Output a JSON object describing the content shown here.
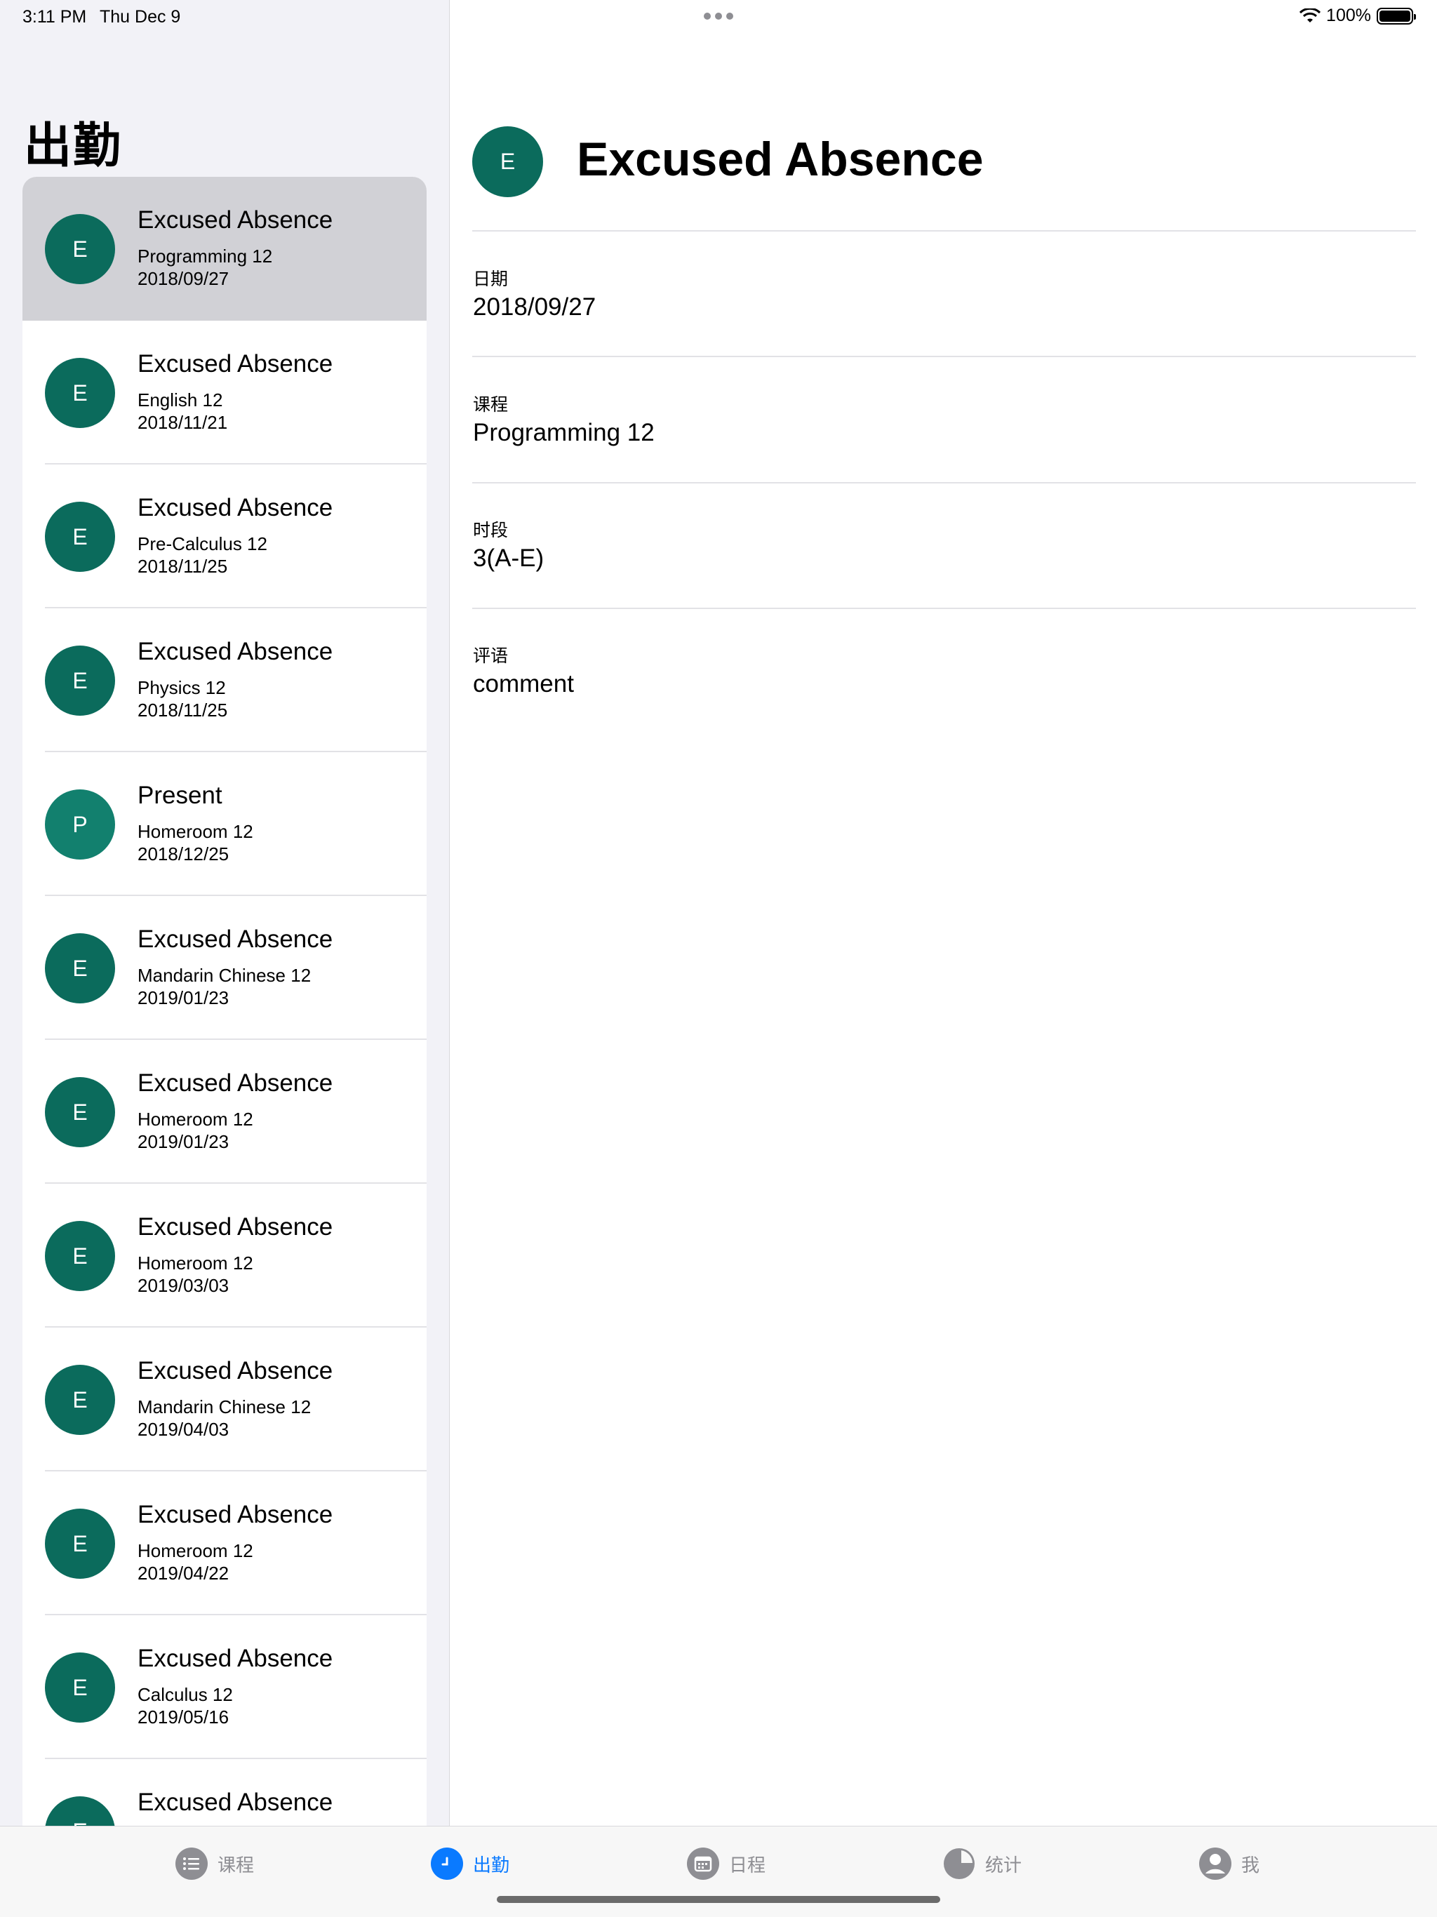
{
  "status_bar": {
    "time": "3:11 PM",
    "date": "Thu Dec 9",
    "battery": "100%"
  },
  "sidebar": {
    "title": "出勤",
    "items": [
      {
        "avatar": "E",
        "title": "Excused Absence",
        "course": "Programming 12",
        "date": "2018/09/27"
      },
      {
        "avatar": "E",
        "title": "Excused Absence",
        "course": "English 12",
        "date": "2018/11/21"
      },
      {
        "avatar": "E",
        "title": "Excused Absence",
        "course": "Pre-Calculus 12",
        "date": "2018/11/25"
      },
      {
        "avatar": "E",
        "title": "Excused Absence",
        "course": "Physics 12",
        "date": "2018/11/25"
      },
      {
        "avatar": "P",
        "title": "Present",
        "course": "Homeroom 12",
        "date": "2018/12/25"
      },
      {
        "avatar": "E",
        "title": "Excused Absence",
        "course": "Mandarin Chinese 12",
        "date": "2019/01/23"
      },
      {
        "avatar": "E",
        "title": "Excused Absence",
        "course": "Homeroom 12",
        "date": "2019/01/23"
      },
      {
        "avatar": "E",
        "title": "Excused Absence",
        "course": "Homeroom 12",
        "date": "2019/03/03"
      },
      {
        "avatar": "E",
        "title": "Excused Absence",
        "course": "Mandarin Chinese 12",
        "date": "2019/04/03"
      },
      {
        "avatar": "E",
        "title": "Excused Absence",
        "course": "Homeroom 12",
        "date": "2019/04/22"
      },
      {
        "avatar": "E",
        "title": "Excused Absence",
        "course": "Calculus 12",
        "date": "2019/05/16"
      },
      {
        "avatar": "E",
        "title": "Excused Absence",
        "course": "",
        "date": ""
      }
    ]
  },
  "detail": {
    "avatar": "E",
    "title": "Excused Absence",
    "fields": [
      {
        "label": "日期",
        "value": "2018/09/27"
      },
      {
        "label": "课程",
        "value": "Programming 12"
      },
      {
        "label": "时段",
        "value": "3(A-E)"
      },
      {
        "label": "评语",
        "value": "comment"
      }
    ]
  },
  "tab_bar": {
    "tabs": [
      {
        "label": "课程",
        "icon": "list-icon"
      },
      {
        "label": "出勤",
        "icon": "clock-icon"
      },
      {
        "label": "日程",
        "icon": "calendar-icon"
      },
      {
        "label": "统计",
        "icon": "pie-chart-icon"
      },
      {
        "label": "我",
        "icon": "person-icon"
      }
    ],
    "active_color": "#0a7aff",
    "inactive_color": "#8e8e93"
  },
  "colors": {
    "avatar_excused": "#0b6b5c",
    "avatar_present": "#12806e",
    "selected_row": "#d1d1d6"
  }
}
